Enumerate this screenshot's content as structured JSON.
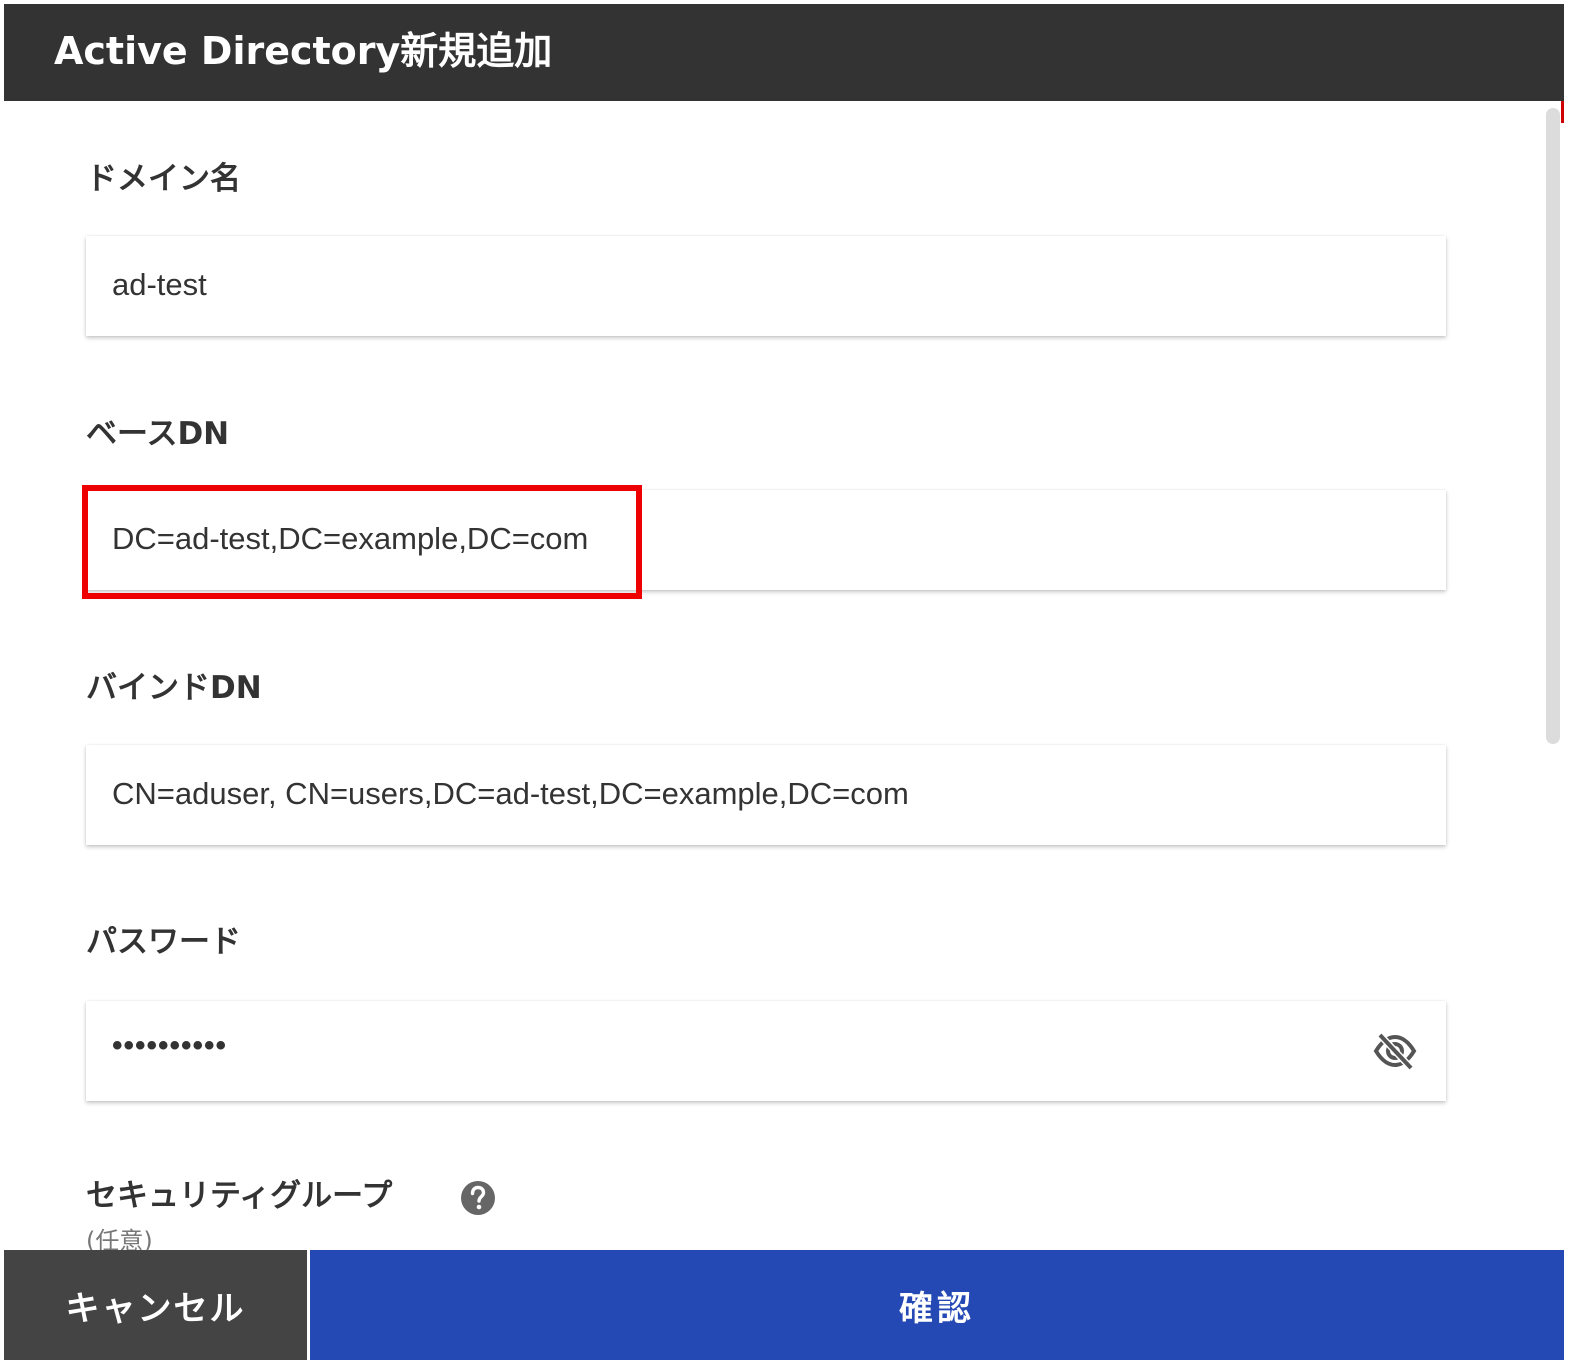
{
  "dialog": {
    "title": "Active Directory新規追加"
  },
  "form": {
    "domain": {
      "label": "ドメイン名",
      "value": "ad-test"
    },
    "base_dn": {
      "label": "ベースDN",
      "value": "DC=ad-test,DC=example,DC=com"
    },
    "bind_dn": {
      "label": "バインドDN",
      "value": "CN=aduser, CN=users,DC=ad-test,DC=example,DC=com"
    },
    "password": {
      "label": "パスワード",
      "value": "••••••••••",
      "toggle_icon": "eye-off-icon"
    },
    "security_group": {
      "label": "セキュリティグループ",
      "optional_note": "(任意)",
      "help_icon": "help-icon"
    }
  },
  "footer": {
    "cancel_label": "キャンセル",
    "confirm_label": "確認"
  },
  "colors": {
    "header_bg": "#333333",
    "confirm_bg": "#2448b4",
    "cancel_bg": "#444444",
    "highlight": "#ee0000"
  }
}
